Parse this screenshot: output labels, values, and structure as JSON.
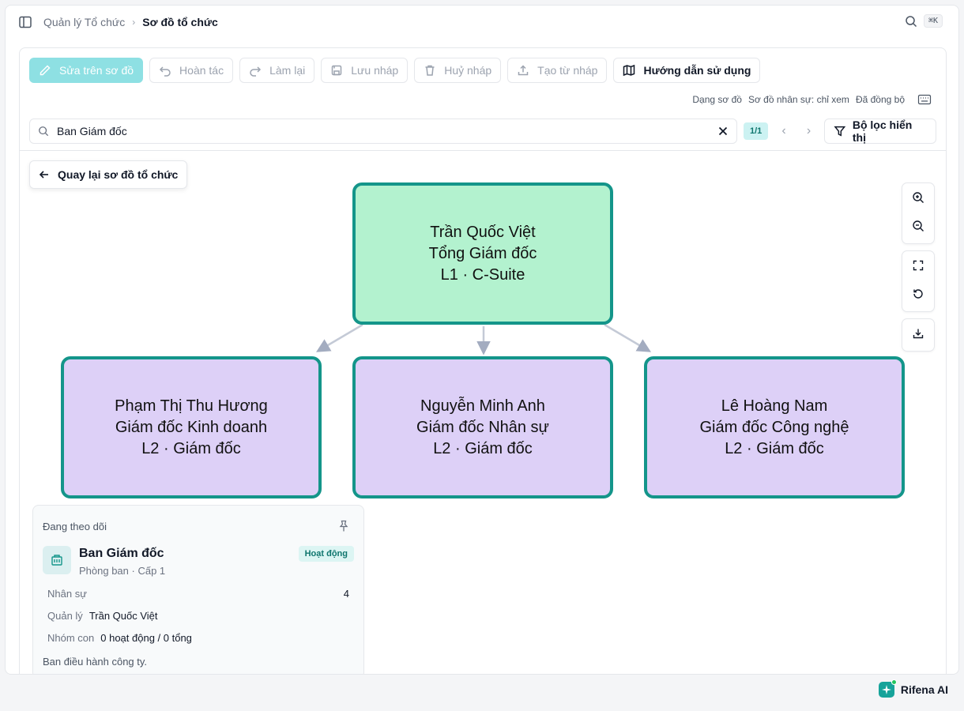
{
  "breadcrumb": {
    "parent": "Quản lý Tổ chức",
    "current": "Sơ đồ tổ chức"
  },
  "shortcut": "⌘K",
  "toolbar": {
    "edit": "Sửa trên sơ đồ",
    "undo": "Hoàn tác",
    "redo": "Làm lại",
    "save_draft": "Lưu nháp",
    "cancel_draft": "Huỷ nháp",
    "create_from_draft": "Tạo từ nháp",
    "guide": "Hướng dẫn sử dụng"
  },
  "meta": {
    "chart_type_label": "Dạng sơ đồ",
    "chart_type_value": "Sơ đồ nhân sự: chỉ xem",
    "sync_status": "Đã đồng bộ"
  },
  "search": {
    "value": "Ban Giám đốc",
    "counter": "1/1",
    "filter_label": "Bộ lọc hiển thị"
  },
  "back_label": "Quay lại sơ đồ tổ chức",
  "org": {
    "root": {
      "name": "Trần Quốc Việt",
      "title": "Tổng Giám đốc",
      "level": "L1 · C-Suite"
    },
    "children": [
      {
        "name": "Phạm Thị Thu Hương",
        "title": "Giám đốc Kinh doanh",
        "level": "L2 · Giám đốc"
      },
      {
        "name": "Nguyễn Minh Anh",
        "title": "Giám đốc Nhân sự",
        "level": "L2 · Giám đốc"
      },
      {
        "name": "Lê Hoàng Nam",
        "title": "Giám đốc Công nghệ",
        "level": "L2 · Giám đốc"
      }
    ]
  },
  "follow": {
    "heading": "Đang theo dõi",
    "dept_name": "Ban Giám đốc",
    "dept_sub": "Phòng ban · Cấp 1",
    "status": "Hoạt động",
    "staff_label": "Nhân sự",
    "staff_value": "4",
    "manager_label": "Quản lý",
    "manager_value": "Trần Quốc Việt",
    "subgroups_label": "Nhóm con",
    "subgroups_value": "0 hoạt động / 0 tổng",
    "description": "Ban điều hành công ty."
  },
  "assistant": "Rifena AI",
  "colors": {
    "accent": "#14958a",
    "root_node": "#b3f2cf",
    "child_node": "#ddd0f7",
    "primary_button": "#8ee0e3"
  }
}
